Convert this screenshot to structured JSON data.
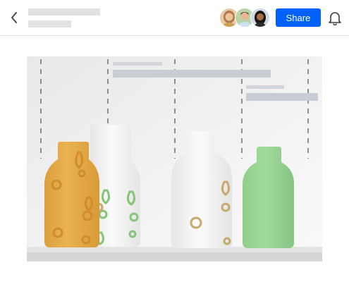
{
  "header": {
    "back_icon": "chevron-left-icon",
    "bell_icon": "bell-icon",
    "share_label": "Share",
    "collaborators": [
      {
        "name": "collaborator-1",
        "skin": "#f0c4a0",
        "hair": "#b27a4a",
        "bg": "#e9c9a6",
        "shirt": "#c9a14f"
      },
      {
        "name": "collaborator-2",
        "skin": "#e8b694",
        "hair": "#3a2a22",
        "bg": "#b9d5a8",
        "shirt": "#cfe1f0"
      },
      {
        "name": "collaborator-3",
        "skin": "#a4704c",
        "hair": "#1d1614",
        "bg": "#cfdce8",
        "shirt": "#2c2c2c"
      }
    ]
  },
  "accent": "#0061fe",
  "colors": {
    "bottle_orange": "#e8ae4a",
    "bottle_white": "#f6f6f6",
    "bottle_green": "#98d594",
    "pattern_green": "#86c47b",
    "pattern_tan": "#c9a86b",
    "placeholder": "#c7cdd3"
  }
}
